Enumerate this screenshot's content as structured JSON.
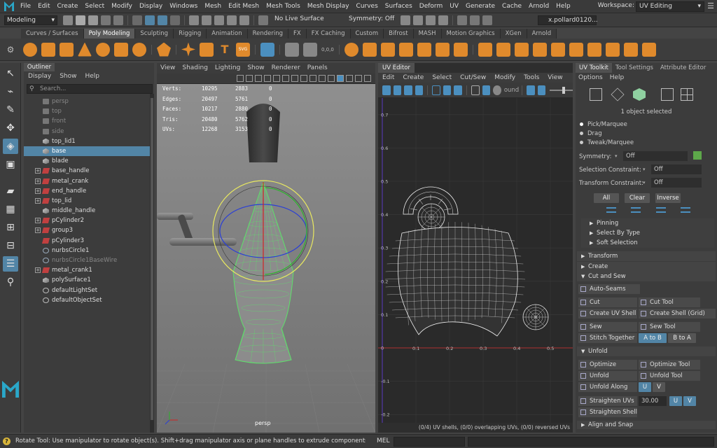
{
  "menubar": {
    "items": [
      "File",
      "Edit",
      "Create",
      "Select",
      "Modify",
      "Display",
      "Windows",
      "Mesh",
      "Edit Mesh",
      "Mesh Tools",
      "Mesh Display",
      "Curves",
      "Surfaces",
      "Deform",
      "UV",
      "Generate",
      "Cache",
      "Arnold",
      "Help"
    ],
    "workspace_label": "Workspace:",
    "workspace_value": "UV Editing"
  },
  "statusline": {
    "mode": "Modeling",
    "live_surface": "No Live Surface",
    "symmetry": "Symmetry: Off",
    "user": "x.pollard0120..."
  },
  "shelf": {
    "tabs": [
      "Curves / Surfaces",
      "Poly Modeling",
      "Sculpting",
      "Rigging",
      "Animation",
      "Rendering",
      "FX",
      "FX Caching",
      "Custom",
      "Bifrost",
      "MASH",
      "Motion Graphics",
      "XGen",
      "Arnold"
    ],
    "active_tab": "Poly Modeling",
    "svg_label": "SVG",
    "uv_label": "0,0,0"
  },
  "outliner": {
    "tab": "Outliner",
    "menu": [
      "Display",
      "Show",
      "Help"
    ],
    "search_placeholder": "Search...",
    "items": [
      {
        "label": "persp",
        "icon": "cam",
        "dim": true,
        "expand": false
      },
      {
        "label": "top",
        "icon": "cam",
        "dim": true,
        "expand": false
      },
      {
        "label": "front",
        "icon": "cam",
        "dim": true,
        "expand": false
      },
      {
        "label": "side",
        "icon": "cam",
        "dim": true,
        "expand": false
      },
      {
        "label": "top_lid1",
        "icon": "mesh",
        "dim": false,
        "expand": false
      },
      {
        "label": "base",
        "icon": "mesh",
        "dim": false,
        "expand": false,
        "selected": true
      },
      {
        "label": "blade",
        "icon": "mesh",
        "dim": false,
        "expand": false
      },
      {
        "label": "base_handle",
        "icon": "grp",
        "dim": false,
        "expand": true
      },
      {
        "label": "metal_crank",
        "icon": "grp",
        "dim": false,
        "expand": true
      },
      {
        "label": "end_handle",
        "icon": "grp",
        "dim": false,
        "expand": true
      },
      {
        "label": "top_lid",
        "icon": "grp",
        "dim": false,
        "expand": true
      },
      {
        "label": "middle_handle",
        "icon": "mesh",
        "dim": false,
        "expand": false
      },
      {
        "label": "pCylinder2",
        "icon": "grp",
        "dim": false,
        "expand": true
      },
      {
        "label": "group3",
        "icon": "grp",
        "dim": false,
        "expand": true
      },
      {
        "label": "pCylinder3",
        "icon": "grp",
        "dim": false,
        "expand": false
      },
      {
        "label": "nurbsCircle1",
        "icon": "curve",
        "dim": false,
        "expand": false
      },
      {
        "label": "nurbsCircle1BaseWire",
        "icon": "curve",
        "dim": true,
        "expand": false
      },
      {
        "label": "metal_crank1",
        "icon": "grp",
        "dim": false,
        "expand": true
      },
      {
        "label": "polySurface1",
        "icon": "mesh",
        "dim": false,
        "expand": false
      },
      {
        "label": "defaultLightSet",
        "icon": "set",
        "dim": false,
        "expand": false
      },
      {
        "label": "defaultObjectSet",
        "icon": "set",
        "dim": false,
        "expand": false
      }
    ]
  },
  "viewport": {
    "menu": [
      "View",
      "Shading",
      "Lighting",
      "Show",
      "Renderer",
      "Panels"
    ],
    "hud": [
      {
        "label": "Verts:",
        "v1": "10295",
        "v2": "2883",
        "v3": "0"
      },
      {
        "label": "Edges:",
        "v1": "20497",
        "v2": "5761",
        "v3": "0"
      },
      {
        "label": "Faces:",
        "v1": "10217",
        "v2": "2880",
        "v3": "0"
      },
      {
        "label": "Tris:",
        "v1": "20480",
        "v2": "5762",
        "v3": "0"
      },
      {
        "label": "UVs:",
        "v1": "12268",
        "v2": "3153",
        "v3": "0"
      }
    ],
    "camera_label": "persp"
  },
  "uveditor": {
    "tab": "UV Editor",
    "menu": [
      "Edit",
      "Create",
      "Select",
      "Cut/Sew",
      "Modify",
      "Tools",
      "View"
    ],
    "round_label": "ound",
    "y_ticks": [
      "0.7",
      "0.6",
      "0.5",
      "0.4",
      "0.3",
      "0.2",
      "0.1",
      "0",
      "-0.1",
      "-0.2"
    ],
    "x_ticks": [
      "0.1",
      "0.2",
      "0.3",
      "0.4",
      "0.5"
    ],
    "status": "(0/4) UV shells, (0/0) overlapping UVs, (0/0) reversed UVs"
  },
  "toolkit": {
    "tabs": [
      "UV Toolkit",
      "Tool Settings",
      "Attribute Editor"
    ],
    "menu": [
      "Options",
      "Help"
    ],
    "selection_count": "1 object selected",
    "modes": [
      "Pick/Marquee",
      "Drag",
      "Tweak/Marquee"
    ],
    "symmetry_label": "Symmetry:",
    "symmetry_value": "Off",
    "sel_constraint_label": "Selection Constraint:",
    "sel_constraint_value": "Off",
    "xform_constraint_label": "Transform Constraint:",
    "xform_constraint_value": "Off",
    "select_buttons": [
      "All",
      "Clear",
      "Inverse"
    ],
    "sub_sections": [
      "Pinning",
      "Select By Type",
      "Soft Selection"
    ],
    "transform_label": "Transform",
    "create_label": "Create",
    "cutsew_label": "Cut and Sew",
    "auto_seams": "Auto-Seams",
    "cut": "Cut",
    "cut_tool": "Cut Tool",
    "create_shell": "Create UV Shell",
    "create_shell_grid": "Create Shell (Grid)",
    "sew": "Sew",
    "sew_tool": "Sew Tool",
    "stitch": "Stitch Together",
    "a_to_b": "A to B",
    "b_to_a": "B to A",
    "unfold_label": "Unfold",
    "optimize": "Optimize",
    "optimize_tool": "Optimize Tool",
    "unfold": "Unfold",
    "unfold_tool": "Unfold Tool",
    "unfold_along": "Unfold Along",
    "u": "U",
    "v": "V",
    "straighten_uvs": "Straighten UVs",
    "straighten_value": "30.00",
    "straighten_shell": "Straighten Shell",
    "align_snap": "Align and Snap"
  },
  "helpline": {
    "text": "Rotate Tool: Use manipulator to rotate object(s). Shift+drag manipulator axis or plane handles to extrude components or clone objects. Ctrl+S",
    "mel": "MEL"
  }
}
